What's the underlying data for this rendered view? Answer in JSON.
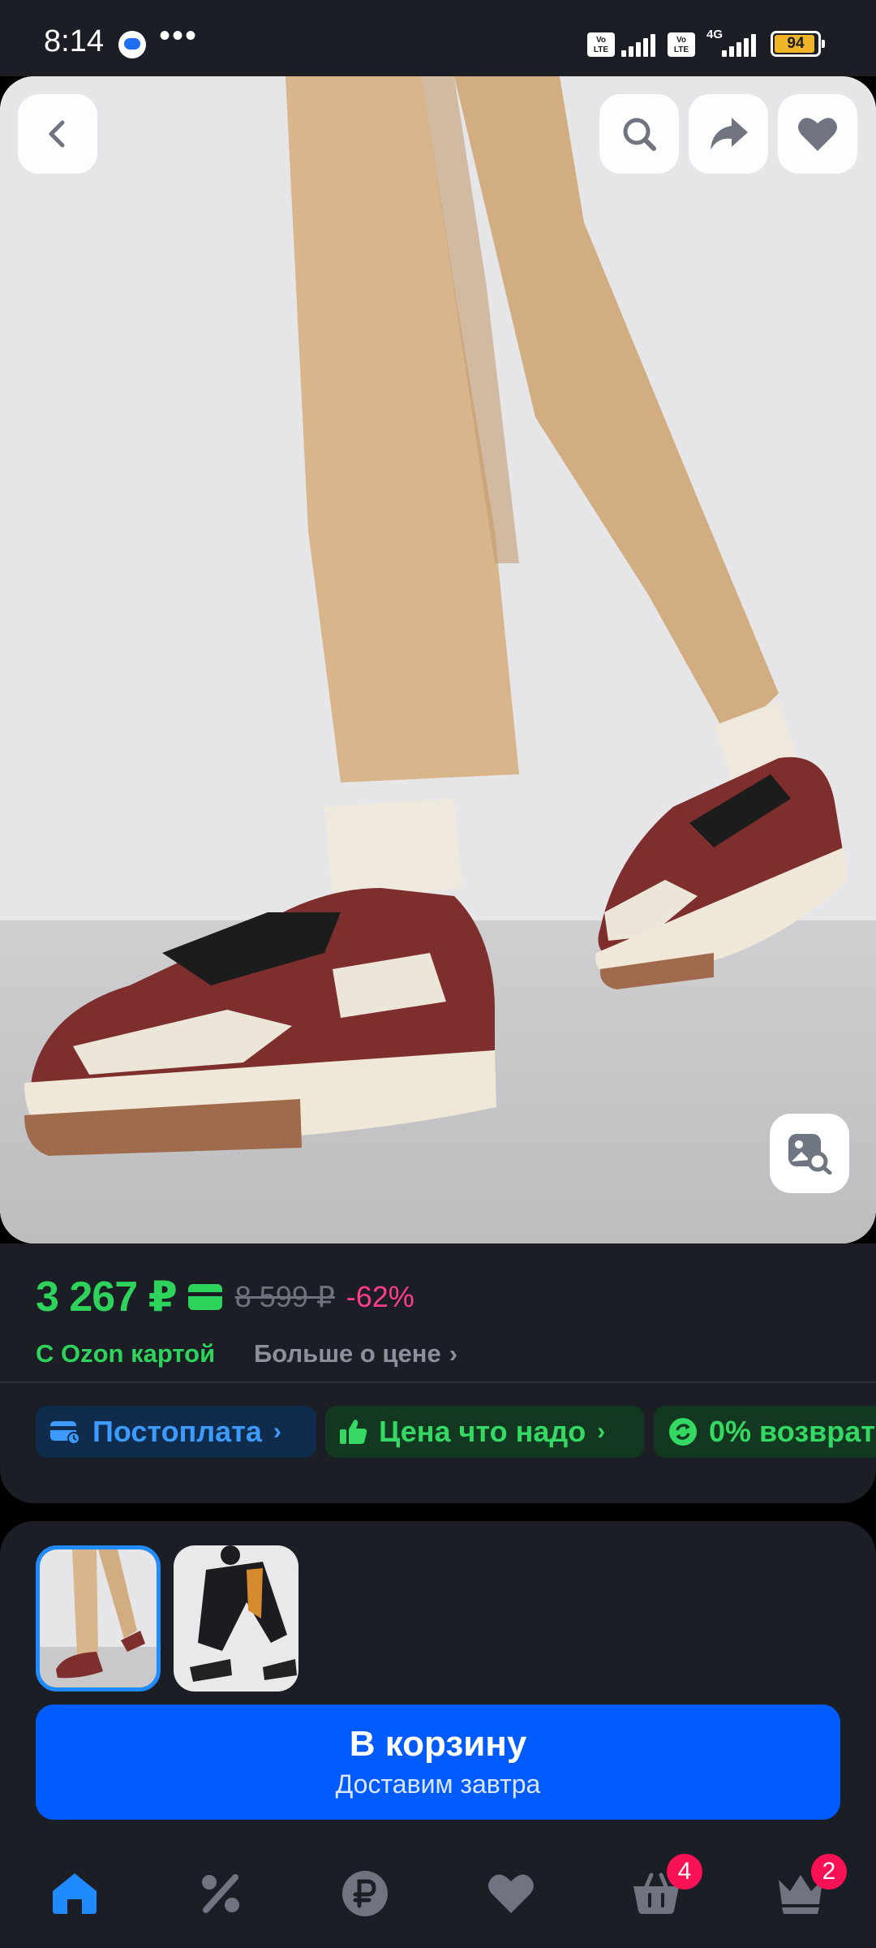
{
  "status_bar": {
    "time": "8:14",
    "dots": "•••",
    "network_sim1": "Vo LTE",
    "network_sim2": "Vo LTE",
    "network_type": "4G",
    "battery_level": "94"
  },
  "product_photo": {
    "back_icon": "chevron-left-icon",
    "search_icon": "search-icon",
    "share_icon": "share-arrow-icon",
    "favorite_icon": "heart-icon",
    "visual_search_icon": "image-search-icon"
  },
  "price": {
    "current": "3 267 ₽",
    "old": "8 599 ₽",
    "discount": "-62%",
    "ozon_card_label": "С Ozon картой",
    "more_about_price": "Больше о цене",
    "colors": {
      "green": "#2ed35c",
      "pink": "#ff3d8b",
      "muted": "#6e7380"
    }
  },
  "features": [
    {
      "label": "Постоплата",
      "icon": "credit-card-clock-icon"
    },
    {
      "label": "Цена что надо",
      "icon": "thumbs-up-icon"
    },
    {
      "label": "0% возврат",
      "icon": "return-icon"
    }
  ],
  "thumbnails": {
    "selected_index": 0,
    "count": 2
  },
  "cart_button": {
    "title": "В корзину",
    "subtitle": "Доставим завтра",
    "color": "#005bff"
  },
  "bottom_nav": {
    "cart_badge": "4",
    "profile_badge": "2",
    "items": [
      "home-icon",
      "percent-icon",
      "ruble-icon",
      "heart-icon",
      "basket-icon",
      "crown-icon"
    ]
  }
}
